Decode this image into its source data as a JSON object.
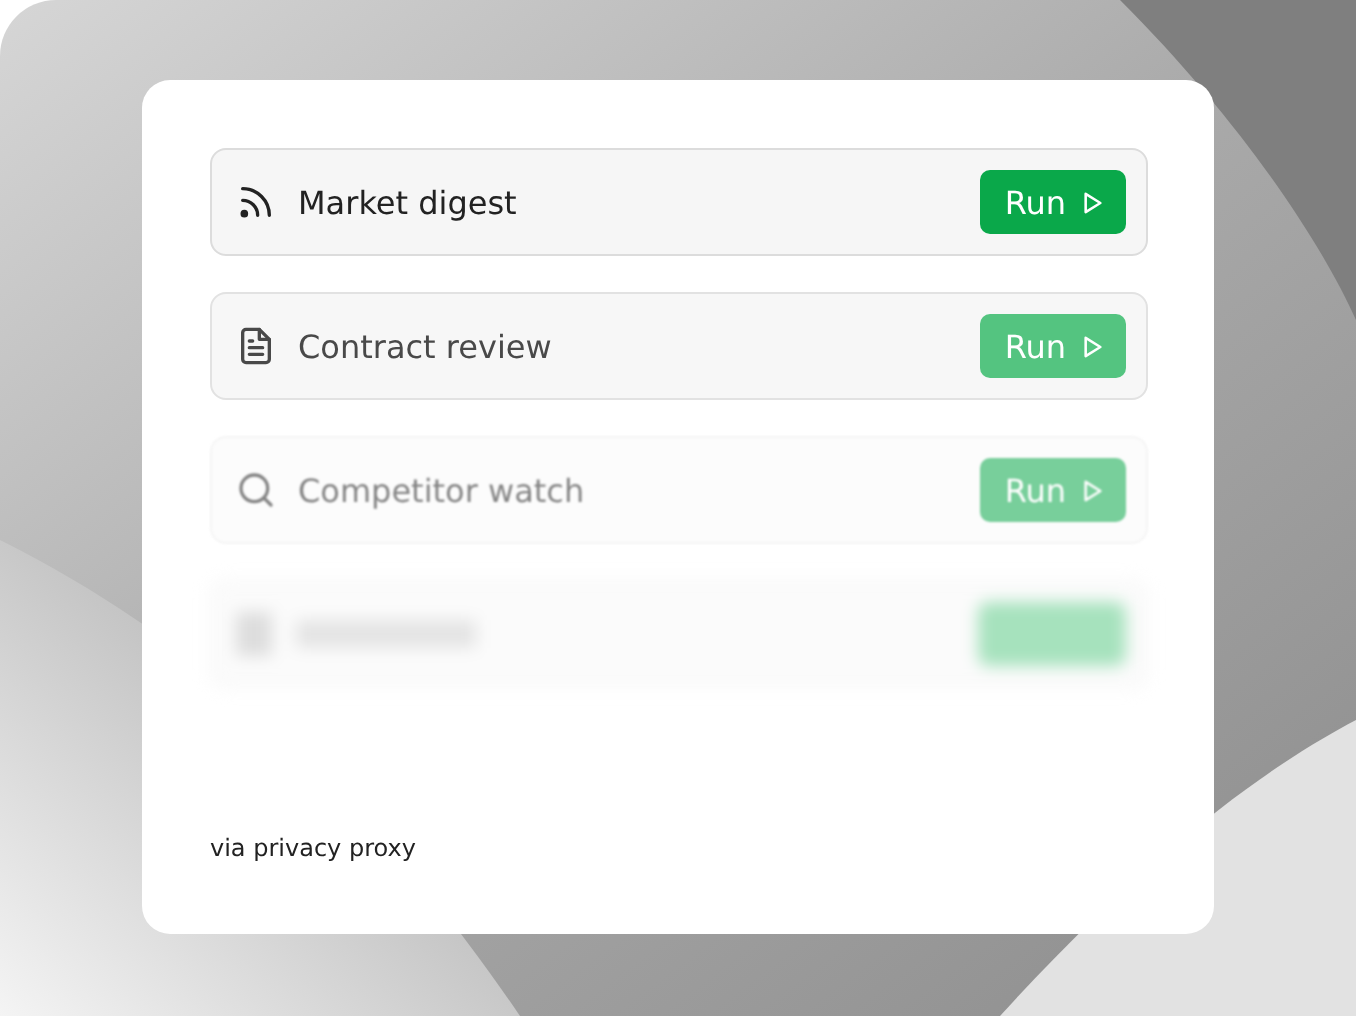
{
  "tasks": [
    {
      "kind": "sharp",
      "label": "Market digest",
      "button": "Run"
    },
    {
      "kind": "dim",
      "label": "Contract review",
      "button": "Run"
    },
    {
      "kind": "faded",
      "label": "Competitor watch",
      "button": "Run"
    },
    {
      "kind": "blurred"
    }
  ],
  "footer": "via privacy proxy"
}
